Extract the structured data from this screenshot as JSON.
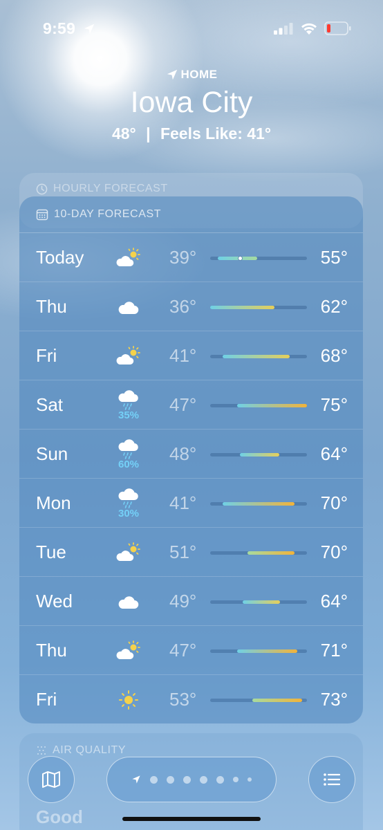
{
  "status": {
    "time": "9:59"
  },
  "header": {
    "location_label": "HOME",
    "city": "Iowa City",
    "current_temp": "48°",
    "separator": "|",
    "feels_like": "Feels Like: 41°"
  },
  "hourly": {
    "title": "HOURLY FORECAST"
  },
  "forecast": {
    "title": "10-DAY FORECAST",
    "scale": {
      "min": 36,
      "max": 75
    },
    "days": [
      {
        "day": "Today",
        "icon": "partly-cloudy-icon",
        "precip": "",
        "low": "39°",
        "high": "55°",
        "low_val": 39,
        "high_val": 55,
        "current_val": 48
      },
      {
        "day": "Thu",
        "icon": "cloud-icon",
        "precip": "",
        "low": "36°",
        "high": "62°",
        "low_val": 36,
        "high_val": 62
      },
      {
        "day": "Fri",
        "icon": "partly-cloudy-icon",
        "precip": "",
        "low": "41°",
        "high": "68°",
        "low_val": 41,
        "high_val": 68
      },
      {
        "day": "Sat",
        "icon": "rain-icon",
        "precip": "35%",
        "low": "47°",
        "high": "75°",
        "low_val": 47,
        "high_val": 75
      },
      {
        "day": "Sun",
        "icon": "rain-icon",
        "precip": "60%",
        "low": "48°",
        "high": "64°",
        "low_val": 48,
        "high_val": 64
      },
      {
        "day": "Mon",
        "icon": "rain-icon",
        "precip": "30%",
        "low": "41°",
        "high": "70°",
        "low_val": 41,
        "high_val": 70
      },
      {
        "day": "Tue",
        "icon": "partly-cloudy-icon",
        "precip": "",
        "low": "51°",
        "high": "70°",
        "low_val": 51,
        "high_val": 70
      },
      {
        "day": "Wed",
        "icon": "cloud-icon",
        "precip": "",
        "low": "49°",
        "high": "64°",
        "low_val": 49,
        "high_val": 64
      },
      {
        "day": "Thu",
        "icon": "partly-cloudy-icon",
        "precip": "",
        "low": "47°",
        "high": "71°",
        "low_val": 47,
        "high_val": 71
      },
      {
        "day": "Fri",
        "icon": "sun-icon",
        "precip": "",
        "low": "53°",
        "high": "73°",
        "low_val": 53,
        "high_val": 73
      }
    ]
  },
  "air_quality": {
    "title": "AIR QUALITY",
    "value": "Good"
  },
  "colors": {
    "cool": "#6fd0e6",
    "mild": "#a6dba0",
    "warm": "#e6cf5a",
    "hot": "#f2b33a"
  }
}
